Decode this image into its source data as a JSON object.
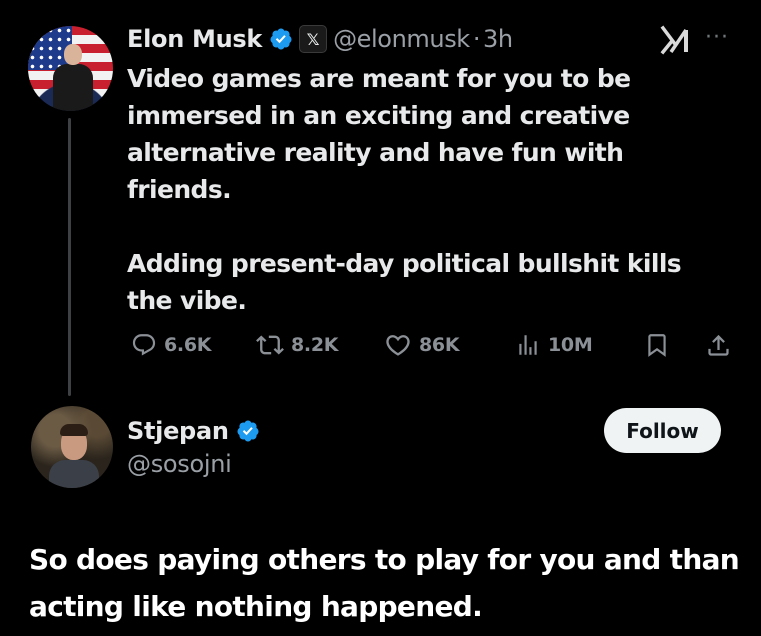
{
  "parent_tweet": {
    "author": {
      "display_name": "Elon Musk",
      "handle": "@elonmusk",
      "affiliation_badge": "𝕏",
      "verified": true
    },
    "separator": "·",
    "time": "3h",
    "paragraphs": [
      "Video games are meant for you to be immersed in an exciting and creative alternative reality and have fun with friends.",
      "Adding present-day political bullshit kills the vibe."
    ],
    "actions": {
      "replies": "6.6K",
      "reposts": "8.2K",
      "likes": "86K",
      "views": "10M"
    },
    "icons": {
      "grok": "grok-icon",
      "more": "more-icon",
      "reply": "reply-icon",
      "repost": "repost-icon",
      "like": "heart-icon",
      "views": "views-icon",
      "bookmark": "bookmark-icon",
      "share": "share-icon"
    }
  },
  "reply": {
    "author": {
      "display_name": "Stjepan",
      "handle": "@sosojni",
      "verified": true
    },
    "follow_label": "Follow",
    "text": "So does paying others to play for you and than acting like nothing happened."
  },
  "colors": {
    "background": "#000000",
    "text": "#e7e9ea",
    "secondary": "#71767b",
    "verified_blue": "#1d9bf0"
  }
}
